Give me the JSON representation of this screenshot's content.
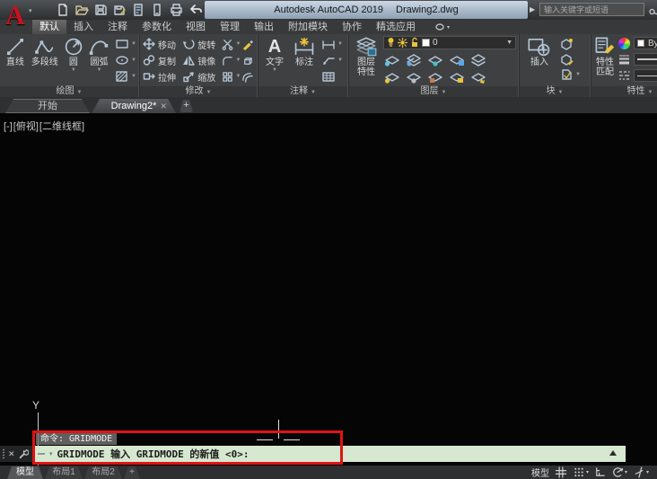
{
  "titlebar": {
    "logo": "A",
    "app": "Autodesk AutoCAD 2019",
    "doc": "Drawing2.dwg",
    "search_placeholder": "输入关键字或短语",
    "qat_icons": [
      "new-file",
      "open-file",
      "save",
      "save-as",
      "plot-stamp",
      "share",
      "print",
      "undo",
      "redo",
      "qat-customize"
    ]
  },
  "ribbon_tabs": [
    "默认",
    "插入",
    "注释",
    "参数化",
    "视图",
    "管理",
    "输出",
    "附加模块",
    "协作",
    "精选应用"
  ],
  "panels": {
    "draw": {
      "label": "绘图",
      "line": "直线",
      "polyline": "多段线",
      "circle": "圆",
      "arc": "圆弧"
    },
    "modify": {
      "label": "修改",
      "move": "移动",
      "rotate": "旋转",
      "copy": "复制",
      "mirror": "镜像",
      "stretch": "拉伸",
      "scale": "缩放"
    },
    "annotate": {
      "label": "注释",
      "a_glyph": "A",
      "text": "文字",
      "dim": "标注"
    },
    "layer": {
      "label": "图层",
      "btn_line1": "图层",
      "btn_line2": "特性",
      "current_layer": "0"
    },
    "block": {
      "label": "块",
      "insert": "插入"
    },
    "props": {
      "label": "特性",
      "match_line1": "特性",
      "match_line2": "匹配",
      "bylayer": "ByLayer"
    }
  },
  "file_tabs": {
    "start": "开始",
    "active": "Drawing2*",
    "close": "✕",
    "add": "+"
  },
  "viewport": {
    "vp_control": "[-]",
    "view_control": "[俯视]",
    "visual_style": "[二维线框]",
    "ucs_axis_label": "Y"
  },
  "command": {
    "history": "命令: GRIDMODE",
    "prompt": "GRIDMODE 输入 GRIDMODE 的新值 <0>:",
    "close": "✕"
  },
  "layout_tabs": {
    "model": "模型",
    "layout1": "布局1",
    "layout2": "布局2",
    "add": "+"
  },
  "statusbar": {
    "model_space": "模型",
    "icons": [
      "grid",
      "snap-mode",
      "ortho",
      "polar-tracking",
      "isodraft"
    ]
  },
  "colors": {
    "command_bg": "#d6e8d0",
    "annotation_red": "#e01313",
    "icon_blue": "#b4c6d6",
    "layer_yellow": "#e9c43c"
  }
}
